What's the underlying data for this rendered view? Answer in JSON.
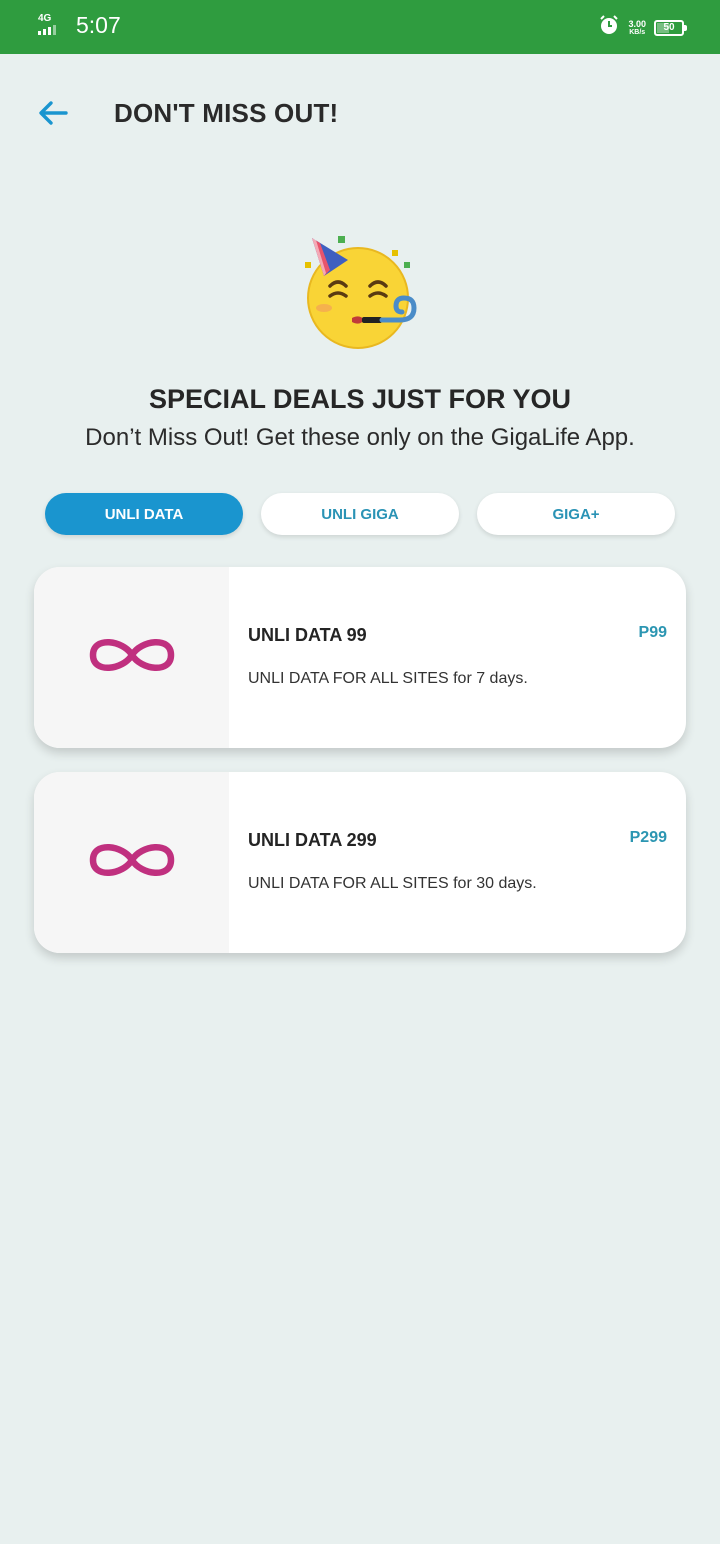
{
  "status_bar": {
    "network": "4G",
    "time": "5:07",
    "speed_value": "3.00",
    "speed_unit": "KB/s",
    "battery": "50",
    "icons": [
      "signal-icon",
      "alarm-icon",
      "battery-icon"
    ]
  },
  "header": {
    "title": "DON'T MISS OUT!",
    "back_icon": "arrow-left-icon"
  },
  "hero": {
    "icon": "party-face-icon",
    "title": "SPECIAL DEALS JUST FOR YOU",
    "subtitle": "Don’t Miss Out! Get these only on the GigaLife App."
  },
  "tabs": [
    {
      "label": "UNLI DATA",
      "active": true
    },
    {
      "label": "UNLI GIGA",
      "active": false
    },
    {
      "label": "GIGA+",
      "active": false
    }
  ],
  "deals": [
    {
      "icon": "infinity-icon",
      "name": "UNLI DATA 99",
      "price": "P99",
      "description": "UNLI DATA FOR ALL SITES for 7 days."
    },
    {
      "icon": "infinity-icon",
      "name": "UNLI DATA 299",
      "price": "P299",
      "description": "UNLI DATA FOR ALL SITES for 30 days."
    }
  ],
  "colors": {
    "status_bar": "#2f9c3f",
    "background": "#e8f0ef",
    "accent": "#1a95cf",
    "price": "#2c96b2",
    "infinity": "#c0307f"
  }
}
